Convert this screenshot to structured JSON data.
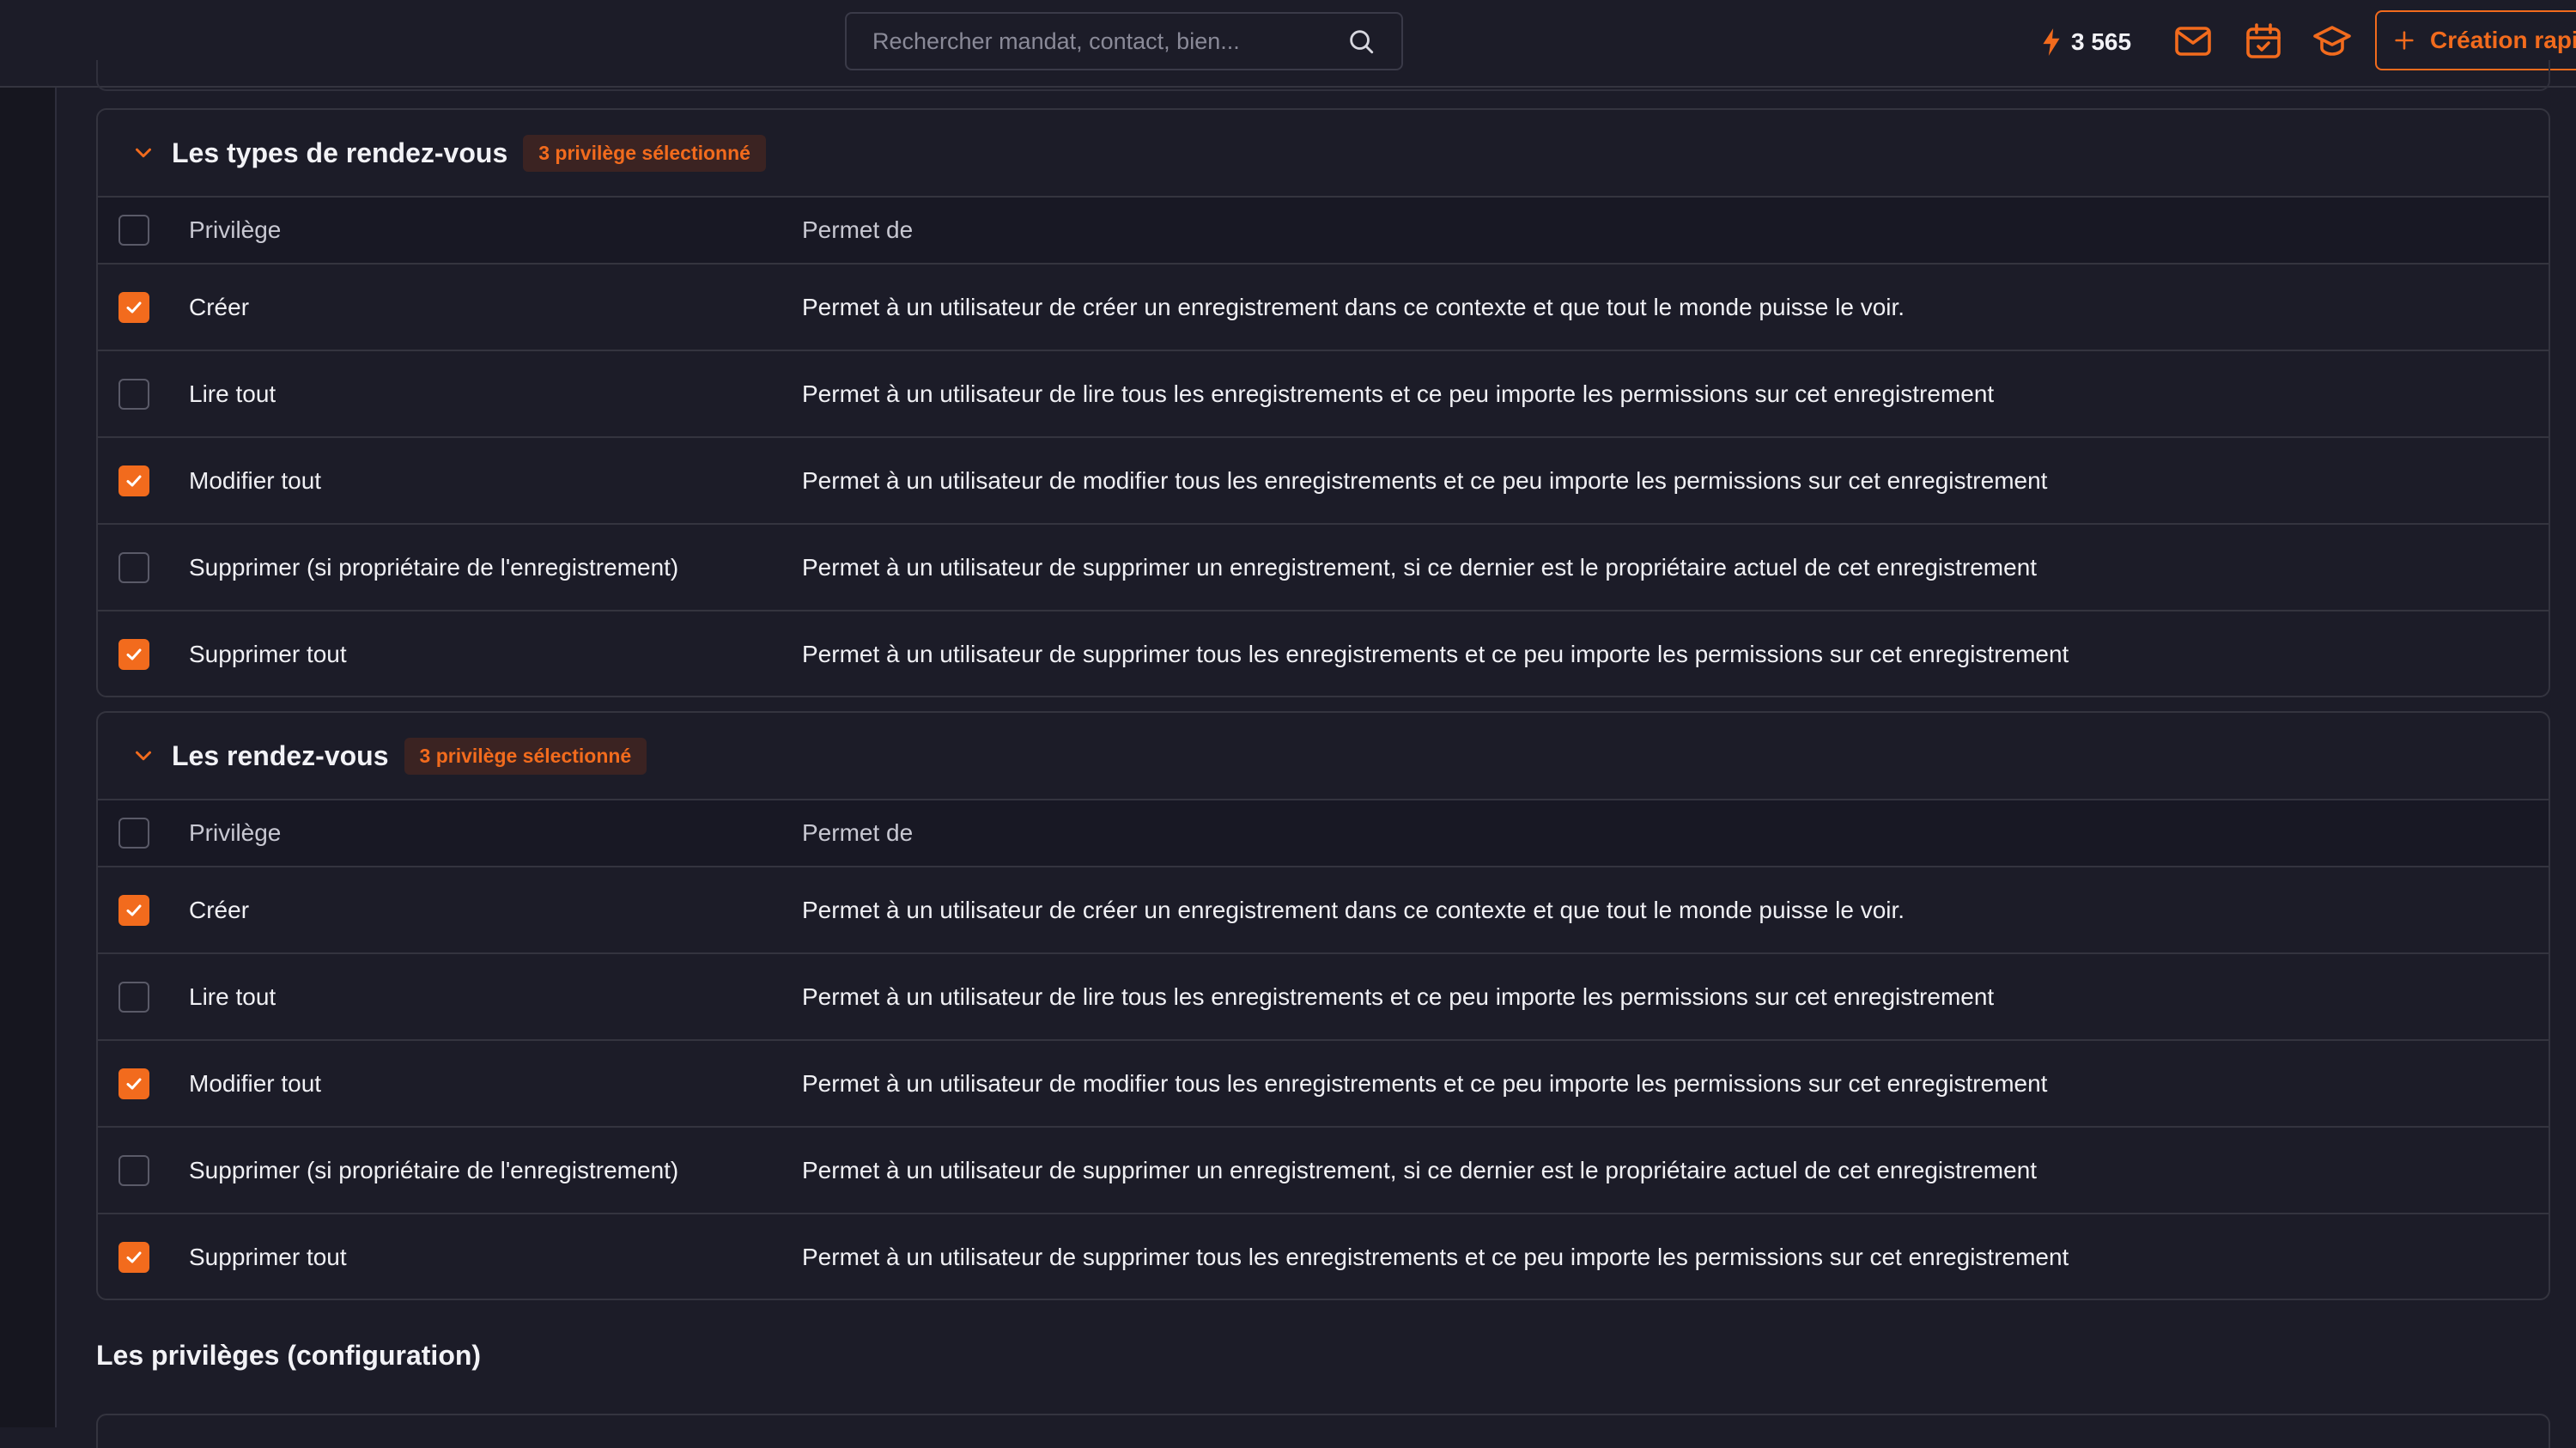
{
  "topbar": {
    "search_placeholder": "Rechercher mandat, contact, bien...",
    "credits": "3 565",
    "quick_create_label": "Création rapi"
  },
  "colors": {
    "accent": "#f26b1d",
    "background": "#1c1c28",
    "border": "#34343f"
  },
  "icons": [
    "search-icon",
    "lightning-icon",
    "mail-icon",
    "calendar-check-icon",
    "graduation-cap-icon",
    "plus-icon",
    "chevron-down-icon",
    "check-icon"
  ],
  "sections": [
    {
      "title": "Les types de rendez-vous",
      "badge": "3 privilège sélectionné",
      "columns": {
        "privilege": "Privilège",
        "description": "Permet de"
      },
      "rows": [
        {
          "privilege": "Créer",
          "description": "Permet à un utilisateur de créer un enregistrement dans ce contexte et que tout le monde puisse le voir.",
          "checked": true
        },
        {
          "privilege": "Lire tout",
          "description": "Permet à un utilisateur de lire tous les enregistrements et ce peu importe les permissions sur cet enregistrement",
          "checked": false
        },
        {
          "privilege": "Modifier tout",
          "description": "Permet à un utilisateur de modifier tous les enregistrements et ce peu importe les permissions sur cet enregistrement",
          "checked": true
        },
        {
          "privilege": "Supprimer (si propriétaire de l'enregistrement)",
          "description": "Permet à un utilisateur de supprimer un enregistrement, si ce dernier est le propriétaire actuel de cet enregistrement",
          "checked": false
        },
        {
          "privilege": "Supprimer tout",
          "description": "Permet à un utilisateur de supprimer tous les enregistrements et ce peu importe les permissions sur cet enregistrement",
          "checked": true
        }
      ]
    },
    {
      "title": "Les rendez-vous",
      "badge": "3 privilège sélectionné",
      "columns": {
        "privilege": "Privilège",
        "description": "Permet de"
      },
      "rows": [
        {
          "privilege": "Créer",
          "description": "Permet à un utilisateur de créer un enregistrement dans ce contexte et que tout le monde puisse le voir.",
          "checked": true
        },
        {
          "privilege": "Lire tout",
          "description": "Permet à un utilisateur de lire tous les enregistrements et ce peu importe les permissions sur cet enregistrement",
          "checked": false
        },
        {
          "privilege": "Modifier tout",
          "description": "Permet à un utilisateur de modifier tous les enregistrements et ce peu importe les permissions sur cet enregistrement",
          "checked": true
        },
        {
          "privilege": "Supprimer (si propriétaire de l'enregistrement)",
          "description": "Permet à un utilisateur de supprimer un enregistrement, si ce dernier est le propriétaire actuel de cet enregistrement",
          "checked": false
        },
        {
          "privilege": "Supprimer tout",
          "description": "Permet à un utilisateur de supprimer tous les enregistrements et ce peu importe les permissions sur cet enregistrement",
          "checked": true
        }
      ]
    }
  ],
  "config_section_title": "Les privilèges (configuration)"
}
